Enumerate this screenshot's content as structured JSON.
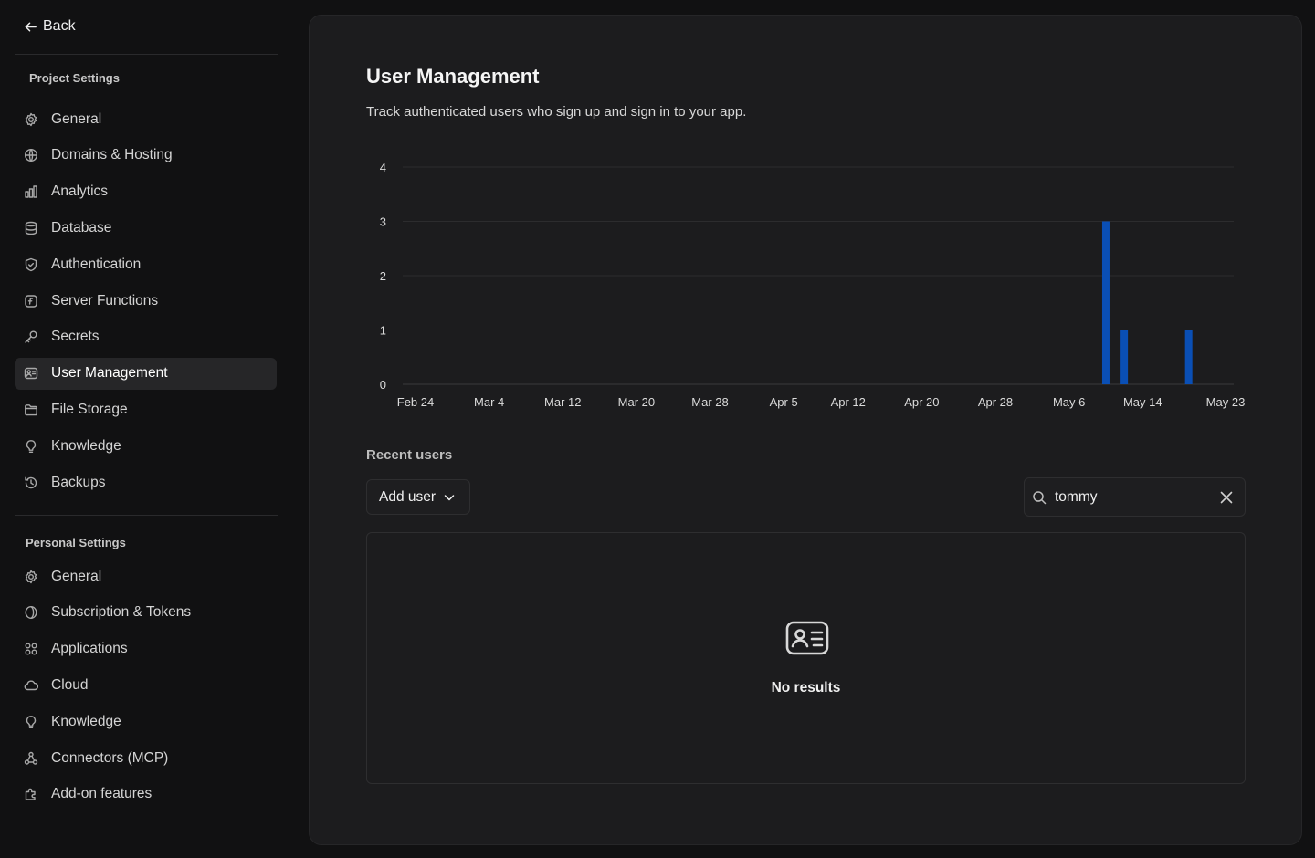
{
  "back_label": "Back",
  "sidebar": {
    "project_section_title": "Project Settings",
    "project_items": [
      {
        "label": "General",
        "icon": "gear-icon"
      },
      {
        "label": "Domains & Hosting",
        "icon": "globe-icon"
      },
      {
        "label": "Analytics",
        "icon": "bar-chart-icon"
      },
      {
        "label": "Database",
        "icon": "database-icon"
      },
      {
        "label": "Authentication",
        "icon": "shield-icon"
      },
      {
        "label": "Server Functions",
        "icon": "function-icon"
      },
      {
        "label": "Secrets",
        "icon": "key-icon"
      },
      {
        "label": "User Management",
        "icon": "id-card-icon",
        "active": true
      },
      {
        "label": "File Storage",
        "icon": "folder-icon"
      },
      {
        "label": "Knowledge",
        "icon": "lightbulb-icon"
      },
      {
        "label": "Backups",
        "icon": "history-icon"
      }
    ],
    "personal_section_title": "Personal Settings",
    "personal_items": [
      {
        "label": "General",
        "icon": "gear-icon"
      },
      {
        "label": "Subscription & Tokens",
        "icon": "coin-icon"
      },
      {
        "label": "Applications",
        "icon": "apps-grid-icon"
      },
      {
        "label": "Cloud",
        "icon": "cloud-icon"
      },
      {
        "label": "Knowledge",
        "icon": "lightbulb-icon"
      },
      {
        "label": "Connectors (MCP)",
        "icon": "connectors-icon"
      },
      {
        "label": "Add-on features",
        "icon": "puzzle-icon"
      }
    ]
  },
  "main": {
    "title": "User Management",
    "subtitle": "Track authenticated users who sign up and sign in to your app.",
    "recent_users_title": "Recent users",
    "add_user_label": "Add user",
    "search_value": "tommy",
    "empty_state_text": "No results"
  },
  "colors": {
    "bar": "#0a4fb5",
    "background": "#111112",
    "panel": "#1c1c1e"
  },
  "chart_data": {
    "type": "bar",
    "title": "",
    "xlabel": "",
    "ylabel": "",
    "ylim": [
      0,
      4
    ],
    "yticks": [
      0,
      1,
      2,
      3,
      4
    ],
    "x_range": [
      "Feb 24",
      "May 23"
    ],
    "xtick_labels": [
      "Feb 24",
      "Mar 4",
      "Mar 12",
      "Mar 20",
      "Mar 28",
      "Apr 5",
      "Apr 12",
      "Apr 20",
      "Apr 28",
      "May 6",
      "May 14",
      "May 23"
    ],
    "grid": true,
    "series": [
      {
        "points": [
          {
            "x": "May 10",
            "y": 3
          },
          {
            "x": "May 12",
            "y": 1
          },
          {
            "x": "May 19",
            "y": 1
          }
        ]
      }
    ]
  }
}
